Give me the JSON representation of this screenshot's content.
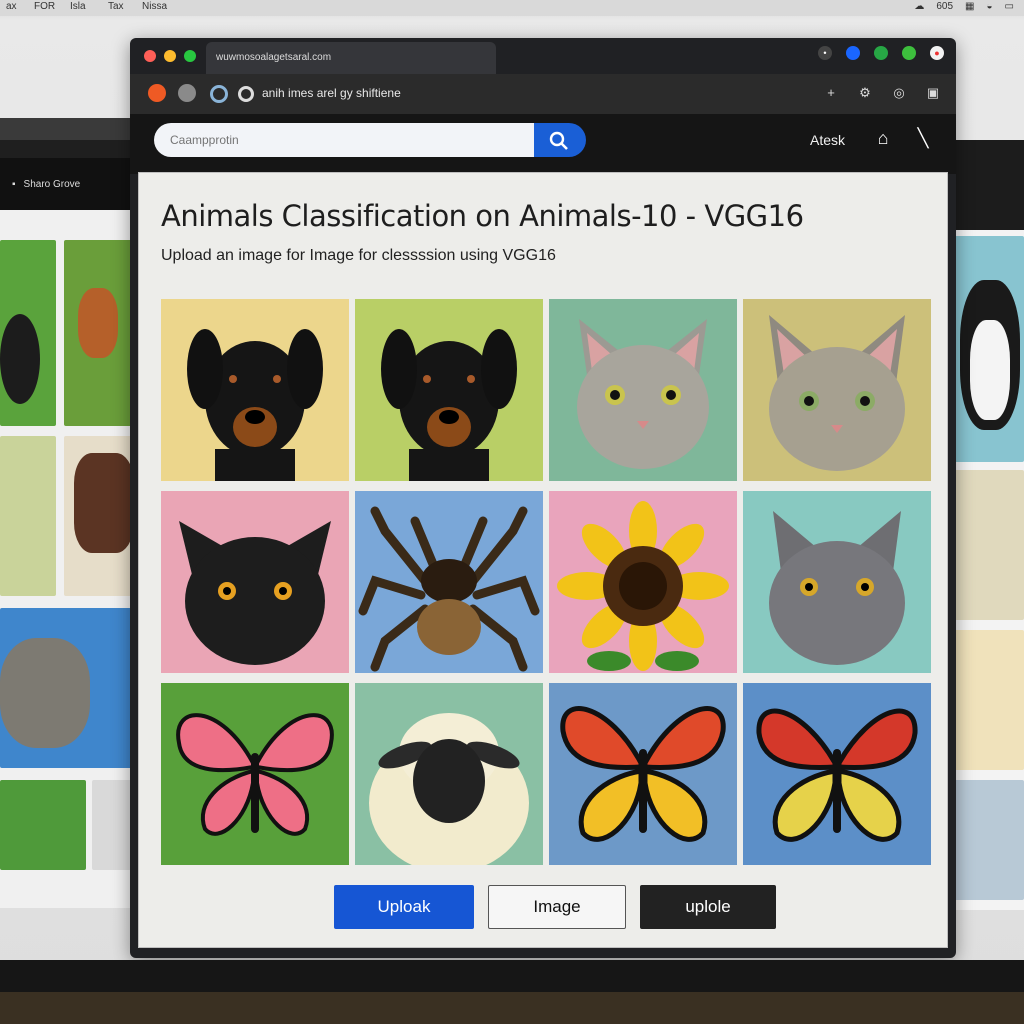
{
  "os_bar": {
    "items": [
      "ax",
      "FOR",
      "Isla",
      "Tax",
      "Nissa"
    ],
    "right_text": "605"
  },
  "browser": {
    "tab_title": "wuwmosoalagetsaral.com",
    "nav_text": "anih imes arel gy shiftiene",
    "search": {
      "placeholder": "Caampprotin"
    },
    "ask_label": "Atesk"
  },
  "background_window": {
    "toolbar_label": "Sharo Grove"
  },
  "page": {
    "title": "Animals Classification on Animals-10 - VGG16",
    "subtitle": "Upload an image for Image for clessssion using VGG16",
    "images": [
      {
        "name": "dog",
        "bg": "#ecd68c"
      },
      {
        "name": "dog",
        "bg": "#b9cf66"
      },
      {
        "name": "cat",
        "bg": "#7fb79a"
      },
      {
        "name": "cat",
        "bg": "#ccc07a"
      },
      {
        "name": "black-cat",
        "bg": "#eaa5b5"
      },
      {
        "name": "spider",
        "bg": "#7aa7d8"
      },
      {
        "name": "sunflower",
        "bg": "#e9a4bc"
      },
      {
        "name": "gray-cat",
        "bg": "#88c9c1"
      },
      {
        "name": "butterfly",
        "bg": "#58a03a"
      },
      {
        "name": "sheep",
        "bg": "#8ac0a4"
      },
      {
        "name": "butterfly",
        "bg": "#6d99c8"
      },
      {
        "name": "butterfly",
        "bg": "#5c8fc8"
      }
    ],
    "buttons": {
      "upload": "Uploak",
      "image": "Image",
      "uplole": "uplole"
    }
  },
  "colors": {
    "accent": "#1656d4",
    "window_dark": "#202124"
  }
}
